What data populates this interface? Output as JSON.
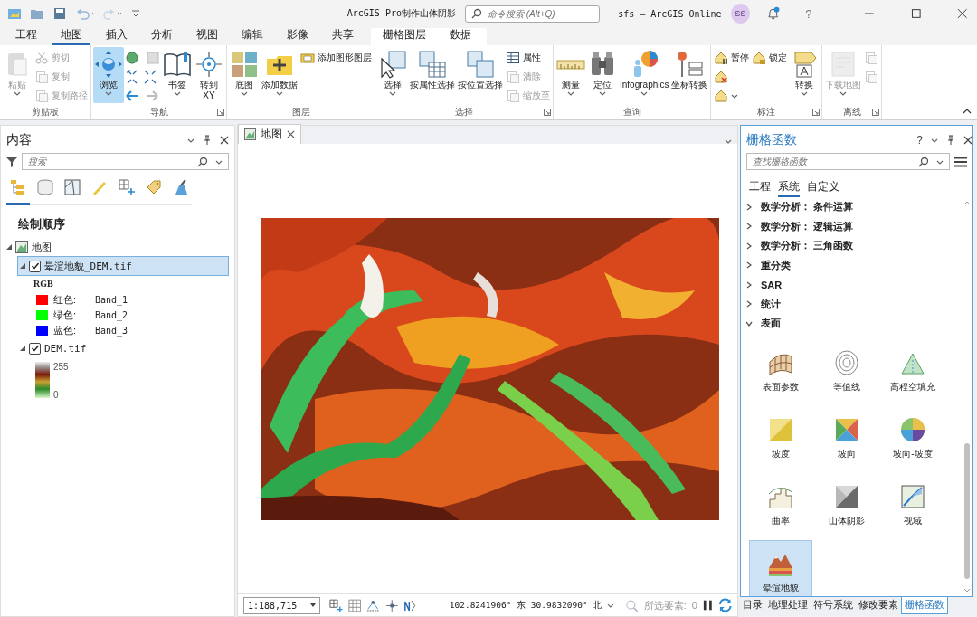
{
  "title_bar": {
    "title": "ArcGIS Pro制作山体阴影",
    "search": {
      "placeholder": "命令搜索 (Alt+Q)"
    },
    "account": "sfs – ArcGIS Online",
    "avatar": "SS",
    "help": "?"
  },
  "ribbon_tabs": [
    {
      "label": "工程",
      "selected": false
    },
    {
      "label": "地图",
      "selected": true
    },
    {
      "label": "插入",
      "selected": false
    },
    {
      "label": "分析",
      "selected": false
    },
    {
      "label": "视图",
      "selected": false
    },
    {
      "label": "编辑",
      "selected": false
    },
    {
      "label": "影像",
      "selected": false
    },
    {
      "label": "共享",
      "selected": false
    }
  ],
  "contextual_tabs": [
    {
      "label": "栅格图层",
      "selected": false
    },
    {
      "label": "数据",
      "selected": false
    }
  ],
  "ribbon_groups": [
    {
      "label": "剪贴板",
      "launcher": false,
      "items": [
        {
          "kind": "large",
          "label": "粘贴",
          "dropdown": true,
          "disabled": true,
          "active": false
        },
        {
          "kind": "small",
          "label": "剪切",
          "dropdown": false,
          "disabled": true
        },
        {
          "kind": "small",
          "label": "复制",
          "dropdown": false,
          "disabled": true
        },
        {
          "kind": "small",
          "label": "复制路径",
          "dropdown": false,
          "disabled": true
        }
      ]
    },
    {
      "label": "导航",
      "launcher": true,
      "items": [
        {
          "kind": "large",
          "label": "浏览",
          "dropdown": true,
          "disabled": false,
          "active": true
        },
        {
          "kind": "icon_grid"
        },
        {
          "kind": "large",
          "label": "书签",
          "dropdown": true,
          "disabled": false,
          "active": false
        },
        {
          "kind": "large",
          "label": "转到\nXY",
          "dropdown": false,
          "disabled": false,
          "active": false
        }
      ]
    },
    {
      "label": "图层",
      "launcher": false,
      "items": [
        {
          "kind": "large",
          "label": "底图",
          "dropdown": true,
          "disabled": false,
          "active": false
        },
        {
          "kind": "large",
          "label": "添加数据",
          "dropdown": true,
          "disabled": false,
          "active": false
        },
        {
          "kind": "small",
          "label": "添加图形图层",
          "dropdown": false,
          "disabled": false
        }
      ]
    },
    {
      "label": "选择",
      "launcher": true,
      "items": [
        {
          "kind": "large",
          "label": "选择",
          "dropdown": true,
          "disabled": false,
          "active": false
        },
        {
          "kind": "large",
          "label": "按属性选择",
          "dropdown": false,
          "disabled": false,
          "active": false
        },
        {
          "kind": "large",
          "label": "按位置选择",
          "dropdown": false,
          "disabled": false,
          "active": false
        },
        {
          "kind": "small",
          "label": "属性",
          "dropdown": false,
          "disabled": false
        },
        {
          "kind": "small",
          "label": "清除",
          "dropdown": false,
          "disabled": true
        },
        {
          "kind": "small",
          "label": "缩放至",
          "dropdown": false,
          "disabled": true
        }
      ]
    },
    {
      "label": "查询",
      "launcher": false,
      "items": [
        {
          "kind": "large",
          "label": "测量",
          "dropdown": true,
          "disabled": false,
          "active": false
        },
        {
          "kind": "large",
          "label": "定位",
          "dropdown": true,
          "disabled": false,
          "active": false
        },
        {
          "kind": "large",
          "label": "Infographics",
          "dropdown": true,
          "disabled": false,
          "active": false
        },
        {
          "kind": "large",
          "label": "坐标转换",
          "dropdown": false,
          "disabled": false,
          "active": false
        }
      ]
    },
    {
      "label": "标注",
      "launcher": true,
      "items": [
        {
          "kind": "small",
          "label": "暂停",
          "dropdown": false,
          "disabled": false
        },
        {
          "kind": "small",
          "dropdown": false,
          "disabled": false
        },
        {
          "kind": "small",
          "dropdown": true,
          "disabled": false
        },
        {
          "kind": "small",
          "label": "锁定",
          "dropdown": false,
          "disabled": false
        },
        {
          "kind": "large",
          "label": "转换",
          "dropdown": true,
          "disabled": false,
          "active": false
        }
      ]
    },
    {
      "label": "离线",
      "launcher": true,
      "items": [
        {
          "kind": "large",
          "label": "下载地图",
          "dropdown": true,
          "disabled": true,
          "active": false
        },
        {
          "kind": "small",
          "dropdown": false,
          "disabled": true
        },
        {
          "kind": "small",
          "dropdown": false,
          "disabled": true
        }
      ]
    }
  ],
  "contents": {
    "title": "内容",
    "search": {
      "placeholder": "搜索"
    },
    "view_tabs": [
      {
        "selected": true
      },
      {
        "selected": false
      },
      {
        "selected": false
      },
      {
        "selected": false
      },
      {
        "selected": false
      },
      {
        "selected": false
      },
      {
        "selected": false
      }
    ],
    "section": "绘制顺序",
    "tree": [
      {
        "kind": "map",
        "label": "地图",
        "expanded": true,
        "children": [
          {
            "kind": "layer",
            "label": "晕渲地貌_DEM.tif",
            "checked": true,
            "selected": true,
            "expanded": true,
            "legend": {
              "kind": "rgb",
              "heading": "RGB",
              "bands": [
                {
                  "label": "红色:",
                  "band": "Band_1",
                  "color": "#ff0000"
                },
                {
                  "label": "绿色:",
                  "band": "Band_2",
                  "color": "#00ff00"
                },
                {
                  "label": "蓝色:",
                  "band": "Band_3",
                  "color": "#0000ff"
                }
              ]
            }
          },
          {
            "kind": "layer",
            "label": "DEM.tif",
            "checked": true,
            "selected": false,
            "expanded": true,
            "legend": {
              "kind": "ramp",
              "high": "255",
              "low": "0"
            }
          }
        ]
      }
    ]
  },
  "map_view": {
    "tab": {
      "label": "地图",
      "selected": true
    },
    "status": {
      "scale": "1:188,715",
      "coordinates": "102.8241906° 东 30.9832090° 北",
      "selected_label": "所选要素:",
      "selected_count": "0"
    }
  },
  "raster_functions": {
    "title": "栅格函数",
    "help": "?",
    "search": {
      "placeholder": "查找栅格函数"
    },
    "tabs": [
      {
        "label": "工程",
        "selected": false
      },
      {
        "label": "系统",
        "selected": true
      },
      {
        "label": "自定义",
        "selected": false
      }
    ],
    "categories": [
      {
        "label": "数学分析： 条件运算",
        "expanded": false
      },
      {
        "label": "数学分析： 逻辑运算",
        "expanded": false
      },
      {
        "label": "数学分析： 三角函数",
        "expanded": false
      },
      {
        "label": "重分类",
        "expanded": false
      },
      {
        "label": "SAR",
        "expanded": false
      },
      {
        "label": "统计",
        "expanded": false
      },
      {
        "label": "表面",
        "expanded": true,
        "functions": [
          {
            "label": "表面参数",
            "selected": false
          },
          {
            "label": "等值线",
            "selected": false
          },
          {
            "label": "高程空填充",
            "selected": false
          },
          {
            "label": "坡度",
            "selected": false
          },
          {
            "label": "坡向",
            "selected": false
          },
          {
            "label": "坡向-坡度",
            "selected": false
          },
          {
            "label": "曲率",
            "selected": false
          },
          {
            "label": "山体阴影",
            "selected": false
          },
          {
            "label": "视域",
            "selected": false
          },
          {
            "label": "晕渲地貌",
            "selected": true
          }
        ]
      }
    ]
  },
  "dock_tabs": [
    {
      "label": "目录",
      "selected": false
    },
    {
      "label": "地理处理",
      "selected": false
    },
    {
      "label": "符号系统",
      "selected": false
    },
    {
      "label": "修改要素",
      "selected": false
    },
    {
      "label": "栅格函数",
      "selected": true
    }
  ]
}
